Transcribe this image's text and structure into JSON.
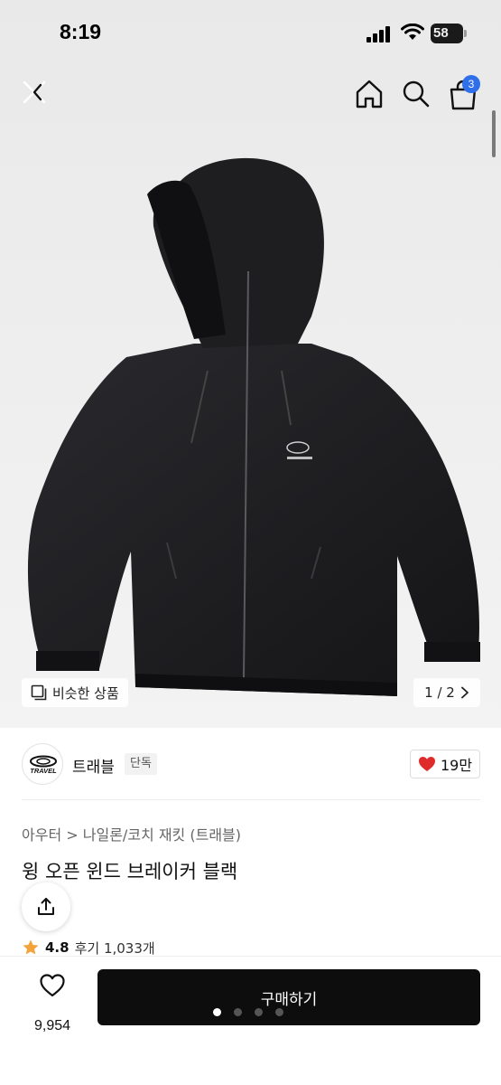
{
  "status_bar": {
    "time": "8:19",
    "battery_level": "58"
  },
  "header": {
    "cart_count": "3"
  },
  "hero": {
    "similar_label": "비슷한 상품",
    "page_current": "1",
    "page_total": "2",
    "page_sep": " / "
  },
  "brand": {
    "name": "트래블",
    "tag": "단독",
    "logo_text": "TRAVEL",
    "likes": "19만"
  },
  "product": {
    "breadcrumb": [
      "아우터",
      "나일론/코치 재킷 (트래블)"
    ],
    "title": "윙 오픈 윈드 브레이커 블랙",
    "rating": "4.8",
    "review_label": "후기 1,033개"
  },
  "bottom": {
    "wish_count": "9,954",
    "buy_label": "구매하기"
  },
  "colors": {
    "accent": "#2f6fea",
    "heart": "#e02b2b",
    "buy_bg": "#0d0d0d",
    "star": "#f2a33a"
  },
  "icons": [
    "close-icon",
    "home-icon",
    "search-icon",
    "bag-icon",
    "gallery-icon",
    "chevron-right-icon",
    "heart-icon",
    "share-icon",
    "star-icon"
  ]
}
